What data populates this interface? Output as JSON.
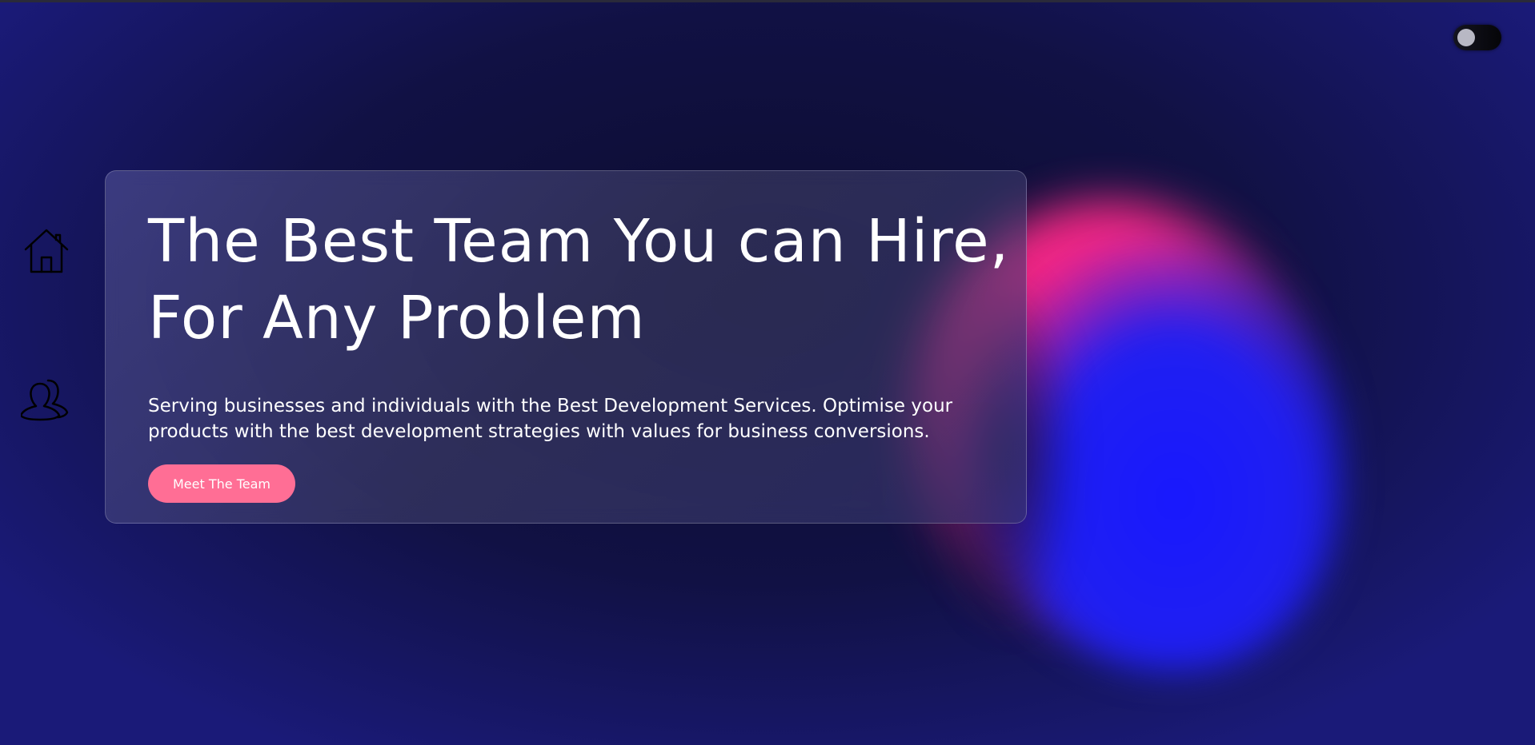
{
  "hero": {
    "title_line1": "The Best Team You can Hire,",
    "title_line2": "For Any Problem",
    "description": "Serving businesses and individuals with the Best Development Services. Optimise your products with the best development strategies with values for business conversions.",
    "cta_label": "Meet The Team"
  },
  "nav": {
    "items": [
      {
        "icon": "home-icon"
      },
      {
        "icon": "team-icon"
      }
    ]
  },
  "theme_toggle": {
    "state": "off"
  },
  "colors": {
    "background": "#111144",
    "accent": "#ff6e95",
    "blob_pink": "#ff1f8e",
    "blob_blue": "#1818ff",
    "text": "#ffffff"
  }
}
